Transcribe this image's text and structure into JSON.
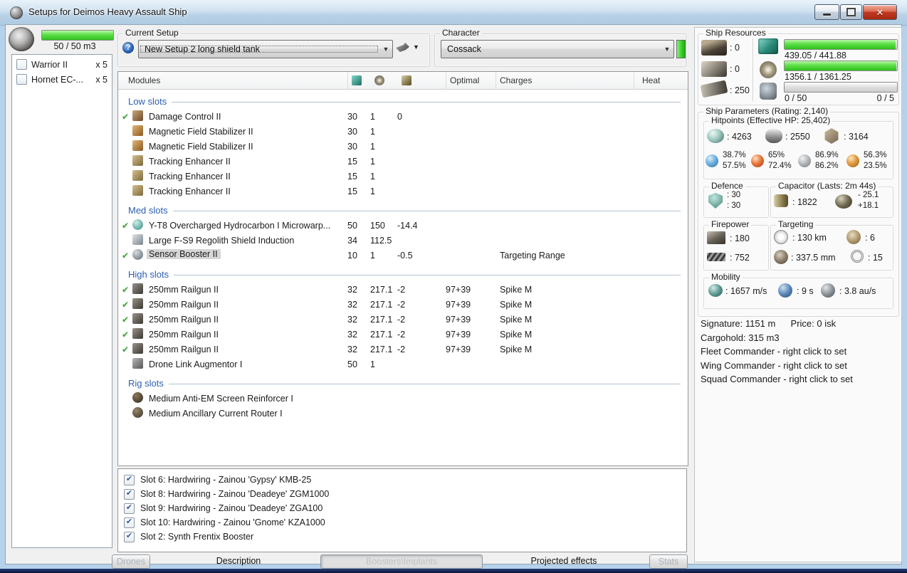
{
  "window": {
    "title": "Setups for Deimos Heavy Assault Ship"
  },
  "colors": {
    "bar_green": "#3ecb2e",
    "check_green": "#3daa35",
    "section_blue": "#2b5fb4",
    "close_red": "#c13a22",
    "character_ok_green": "#30d01e"
  },
  "drone_bay": {
    "capacity": "50 / 50 m3",
    "drones": [
      {
        "checked": false,
        "name": "Warrior II",
        "qty": "x 5"
      },
      {
        "checked": false,
        "name": "Hornet EC-...",
        "qty": "x 5"
      }
    ]
  },
  "current_setup": {
    "label": "Current Setup",
    "value": "New Setup 2 long shield tank"
  },
  "character": {
    "label": "Character",
    "value": "Cossack"
  },
  "modules": {
    "columns": {
      "name": "Modules",
      "optimal": "Optimal",
      "charges": "Charges",
      "heat": "Heat"
    },
    "sections": [
      {
        "label": "Low slots",
        "rows": [
          {
            "check": true,
            "icon": "damage-control",
            "name": "Damage Control II",
            "cpu": "30",
            "pg": "1",
            "cap": "0"
          },
          {
            "icon": "magnetic-field-stabilizer",
            "name": "Magnetic Field Stabilizer II",
            "cpu": "30",
            "pg": "1"
          },
          {
            "icon": "magnetic-field-stabilizer",
            "name": "Magnetic Field Stabilizer II",
            "cpu": "30",
            "pg": "1"
          },
          {
            "icon": "tracking-enhancer",
            "name": "Tracking Enhancer II",
            "cpu": "15",
            "pg": "1"
          },
          {
            "icon": "tracking-enhancer",
            "name": "Tracking Enhancer II",
            "cpu": "15",
            "pg": "1"
          },
          {
            "icon": "tracking-enhancer",
            "name": "Tracking Enhancer II",
            "cpu": "15",
            "pg": "1"
          }
        ]
      },
      {
        "label": "Med slots",
        "rows": [
          {
            "check": true,
            "icon": "microwarpdrive",
            "name": "Y-T8 Overcharged Hydrocarbon I Microwarp...",
            "cpu": "50",
            "pg": "150",
            "cap": "-14.4"
          },
          {
            "icon": "shield-induction",
            "name": "Large F-S9 Regolith Shield Induction",
            "cpu": "34",
            "pg": "112.5"
          },
          {
            "check": true,
            "icon": "sensor-booster",
            "name": "Sensor Booster II",
            "cpu": "10",
            "pg": "1",
            "cap": "-0.5",
            "charges": "Targeting Range",
            "selected": true
          }
        ]
      },
      {
        "label": "High slots",
        "rows": [
          {
            "check": true,
            "icon": "railgun",
            "name": "250mm Railgun II",
            "cpu": "32",
            "pg": "217.1",
            "cap": "-2",
            "optimal": "97+39",
            "charges": "Spike M"
          },
          {
            "check": true,
            "icon": "railgun",
            "name": "250mm Railgun II",
            "cpu": "32",
            "pg": "217.1",
            "cap": "-2",
            "optimal": "97+39",
            "charges": "Spike M"
          },
          {
            "check": true,
            "icon": "railgun",
            "name": "250mm Railgun II",
            "cpu": "32",
            "pg": "217.1",
            "cap": "-2",
            "optimal": "97+39",
            "charges": "Spike M"
          },
          {
            "check": true,
            "icon": "railgun",
            "name": "250mm Railgun II",
            "cpu": "32",
            "pg": "217.1",
            "cap": "-2",
            "optimal": "97+39",
            "charges": "Spike M"
          },
          {
            "check": true,
            "icon": "railgun",
            "name": "250mm Railgun II",
            "cpu": "32",
            "pg": "217.1",
            "cap": "-2",
            "optimal": "97+39",
            "charges": "Spike M"
          },
          {
            "icon": "drone-link",
            "name": "Drone Link Augmentor I",
            "cpu": "50",
            "pg": "1"
          }
        ]
      },
      {
        "label": "Rig slots",
        "rows": [
          {
            "icon": "rig-anti-em",
            "name": "Medium Anti-EM Screen Reinforcer I"
          },
          {
            "icon": "rig-current-router",
            "name": "Medium Ancillary Current Router I"
          }
        ]
      }
    ]
  },
  "implants": {
    "items": [
      {
        "checked": true,
        "label": "Slot 6: Hardwiring - Zainou 'Gypsy' KMB-25"
      },
      {
        "checked": true,
        "label": "Slot 8: Hardwiring - Zainou 'Deadeye' ZGM1000"
      },
      {
        "checked": true,
        "label": "Slot 9: Hardwiring - Zainou 'Deadeye' ZGA100"
      },
      {
        "checked": true,
        "label": "Slot 10: Hardwiring - Zainou 'Gnome' KZA1000"
      },
      {
        "checked": true,
        "label": "Slot 2: Synth Frentix Booster"
      }
    ]
  },
  "tabs": [
    {
      "label": "Drones",
      "style": "button"
    },
    {
      "label": "Description",
      "style": "label"
    },
    {
      "label": "Boosters\\Implants",
      "style": "button-pressed"
    },
    {
      "label": "Projected effects",
      "style": "label"
    },
    {
      "label": "Stats",
      "style": "button"
    }
  ],
  "ship_resources": {
    "label": "Ship Resources",
    "hardpoints": [
      {
        "icon": "turret-hardpoint",
        "value": ": 0"
      },
      {
        "icon": "launcher-hardpoint",
        "value": ": 0"
      },
      {
        "icon": "calibration",
        "value": ": 250"
      }
    ],
    "cpu": {
      "text": "439.05 / 441.88",
      "pct": 99
    },
    "powergrid": {
      "text": "1356.1 / 1361.25",
      "pct": 99.5
    },
    "drones": {
      "left": "0 / 50",
      "right": "0 / 5",
      "pct": 0
    },
    "drone_bay_pct": 100
  },
  "ship_parameters": {
    "label": "Ship Parameters (Rating: 2,140)",
    "hitpoints": {
      "label": "Hitpoints (Effective HP: 25,402)",
      "shield": ": 4263",
      "armor": ": 2550",
      "structure": ": 3164",
      "resists": {
        "em": {
          "top": "38.7%",
          "bottom": "57.5%"
        },
        "thermal": {
          "top": "65%",
          "bottom": "72.4%"
        },
        "kinetic": {
          "top": "86.9%",
          "bottom": "86.2%"
        },
        "explosive": {
          "top": "56.3%",
          "bottom": "23.5%"
        }
      }
    },
    "defence": {
      "label": "Defence",
      "value1": ": 30",
      "value2": ": 30"
    },
    "capacitor": {
      "label": "Capacitor (Lasts: 2m 44s)",
      "amount": ": 1822",
      "drain": "- 25.1",
      "recharge": "+18.1"
    },
    "firepower": {
      "label": "Firepower",
      "dps": ": 180",
      "volley": ": 752"
    },
    "targeting": {
      "label": "Targeting",
      "range": ": 130 km",
      "max_targets": ": 6",
      "scan_resolution": ": 337.5 mm",
      "sensor_strength": ": 15"
    },
    "mobility": {
      "label": "Mobility",
      "speed": ": 1657 m/s",
      "align_time": ": 9 s",
      "warp_speed": ": 3.8 au/s"
    }
  },
  "info": {
    "signature": "Signature: 1151 m",
    "price": "Price: 0 isk",
    "cargohold": "Cargohold: 315 m3",
    "fleet": "Fleet Commander - right click to set",
    "wing": "Wing Commander - right click to set",
    "squad": "Squad Commander - right click to set"
  }
}
